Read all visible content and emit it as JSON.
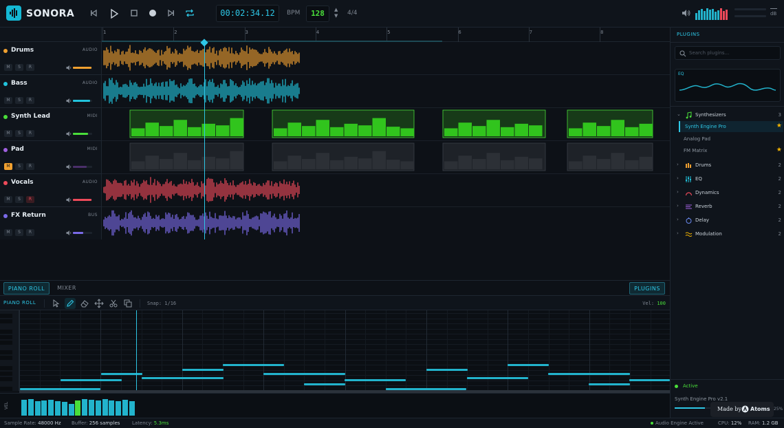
{
  "app": {
    "name": "SONORA"
  },
  "transport": {
    "time": "00:02:34.12",
    "bpm_label": "BPM",
    "bpm": "128",
    "time_signature": "4/4"
  },
  "master": {
    "db_label": "dB"
  },
  "ruler": {
    "bars": [
      "1",
      "2",
      "3",
      "4",
      "5",
      "6",
      "7",
      "8"
    ]
  },
  "tracks": [
    {
      "name": "Drums",
      "type": "AUDIO",
      "color": "#f0a030",
      "mute": "M",
      "solo": "S",
      "record": "R",
      "volume": 0.95,
      "muted": false,
      "armed": false
    },
    {
      "name": "Bass",
      "type": "AUDIO",
      "color": "#22c3dc",
      "mute": "M",
      "solo": "S",
      "record": "R",
      "volume": 0.9,
      "muted": false,
      "armed": false
    },
    {
      "name": "Synth Lead",
      "type": "MIDI",
      "color": "#4ade3a",
      "mute": "M",
      "solo": "S",
      "record": "R",
      "volume": 0.8,
      "muted": false,
      "armed": false
    },
    {
      "name": "Pad",
      "type": "MIDI",
      "color": "#a060e0",
      "mute": "M",
      "solo": "S",
      "record": "R",
      "volume": 0.7,
      "muted": true,
      "armed": false
    },
    {
      "name": "Vocals",
      "type": "AUDIO",
      "color": "#ee4a5a",
      "mute": "M",
      "solo": "S",
      "record": "R",
      "volume": 0.95,
      "muted": false,
      "armed": true
    },
    {
      "name": "FX Return",
      "type": "BUS",
      "color": "#7a6ae8",
      "mute": "M",
      "solo": "S",
      "record": "R",
      "volume": 0.55,
      "muted": false,
      "armed": false
    }
  ],
  "bottom_tabs": {
    "piano_roll": "PIANO ROLL",
    "mixer": "MIXER",
    "plugins": "PLUGINS"
  },
  "piano_roll": {
    "title": "PIANO ROLL",
    "snap": "Snap: 1/16",
    "vel_label": "Vel:",
    "vel_value": "100",
    "vel_axis": "VEL"
  },
  "plugins": {
    "title": "PLUGINS",
    "search_placeholder": "Search plugins...",
    "eq_label": "EQ",
    "categories": [
      {
        "name": "Synthesizers",
        "count": "3",
        "expanded": true,
        "icon": "music-note-icon",
        "color": "#4ade3a"
      },
      {
        "name": "Drums",
        "count": "2",
        "icon": "drums-icon",
        "color": "#f0a030"
      },
      {
        "name": "EQ",
        "count": "2",
        "icon": "eq-icon",
        "color": "#22c3dc"
      },
      {
        "name": "Dynamics",
        "count": "2",
        "icon": "dynamics-icon",
        "color": "#ee4a5a"
      },
      {
        "name": "Reverb",
        "count": "2",
        "icon": "reverb-icon",
        "color": "#a060e0"
      },
      {
        "name": "Delay",
        "count": "2",
        "icon": "delay-icon",
        "color": "#6a8af0"
      },
      {
        "name": "Modulation",
        "count": "2",
        "icon": "modulation-icon",
        "color": "#f4b400"
      }
    ],
    "synths": [
      {
        "name": "Synth Engine Pro",
        "starred": true,
        "selected": true
      },
      {
        "name": "Analog Pad",
        "starred": false,
        "selected": false
      },
      {
        "name": "FM Matrix",
        "starred": true,
        "selected": false
      }
    ],
    "status": "Active",
    "version": "Synth Engine Pro v2.1",
    "load_pct_label": "25%"
  },
  "status_bar": {
    "sample_rate_label": "Sample Rate:",
    "sample_rate": "48000 Hz",
    "buffer_label": "Buffer:",
    "buffer": "256 samples",
    "latency_label": "Latency:",
    "latency": "5.3ms",
    "engine": "Audio Engine Active",
    "cpu_label": "CPU:",
    "cpu": "12%",
    "ram_label": "RAM:",
    "ram": "1.2 GB"
  },
  "badge": {
    "made_by": "Made by",
    "brand": "Atoms"
  }
}
